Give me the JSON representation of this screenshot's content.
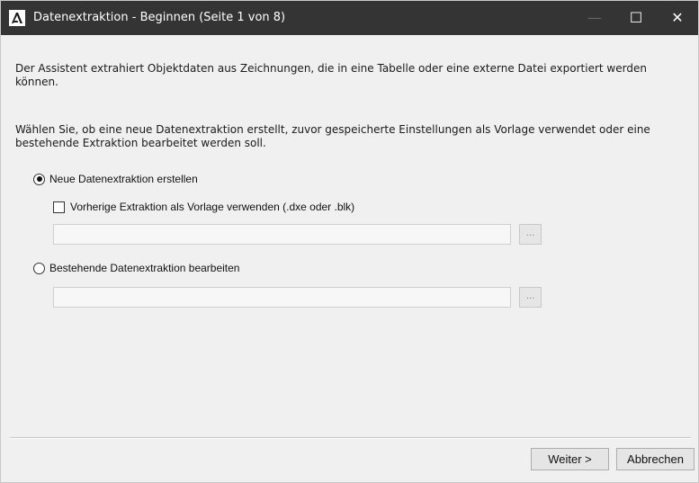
{
  "window": {
    "title": "Datenextraktion - Beginnen (Seite 1 von 8)",
    "controls": {
      "minimize": "—",
      "maximize": "☐",
      "close": "✕"
    },
    "icon": "autocad-a-icon"
  },
  "intro_text": "Der Assistent extrahiert Objektdaten aus Zeichnungen, die in eine Tabelle oder eine externe Datei exportiert werden können.",
  "choice_text": "Wählen Sie, ob eine neue Datenextraktion erstellt, zuvor gespeicherte Einstellungen als Vorlage verwendet oder eine bestehende Extraktion bearbeitet werden soll.",
  "options": {
    "new_label": "Neue Datenextraktion erstellen",
    "new_selected": true,
    "template_checkbox_label": "Vorherige Extraktion als Vorlage verwenden (.dxe oder .blk)",
    "template_checked": false,
    "template_path": "",
    "template_browse_label": "...",
    "edit_label": "Bestehende Datenextraktion bearbeiten",
    "edit_selected": false,
    "edit_path": "",
    "edit_browse_label": "..."
  },
  "buttons": {
    "next": "Weiter >",
    "cancel": "Abbrechen"
  }
}
